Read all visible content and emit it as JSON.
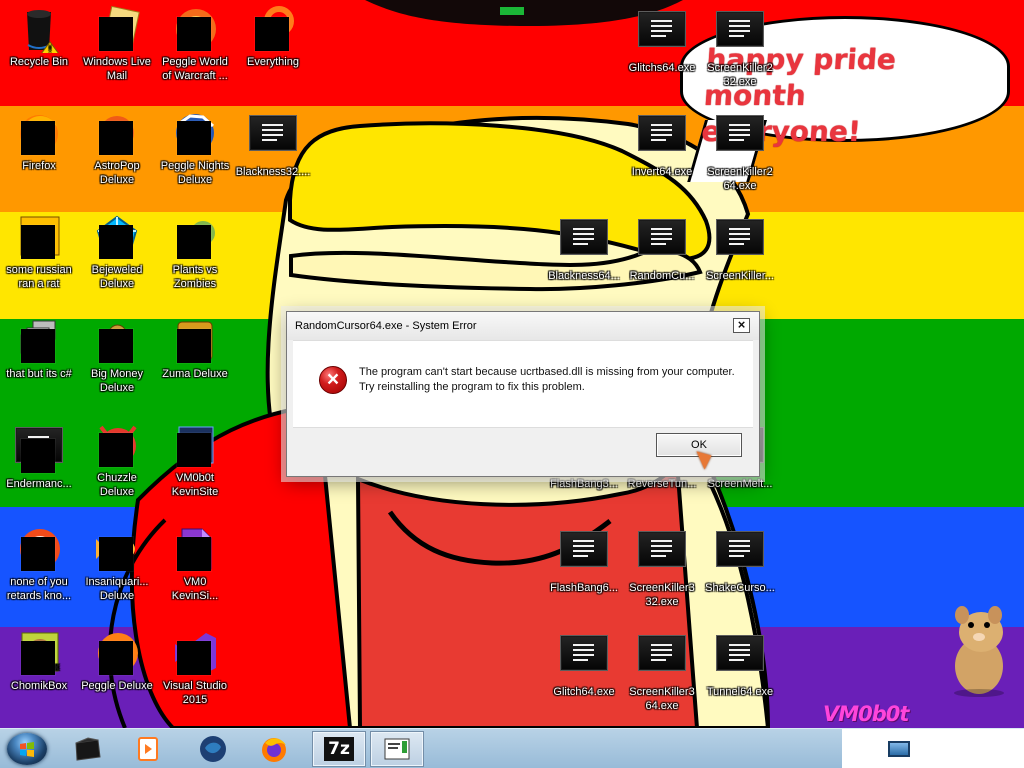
{
  "desktop": {
    "speech_bubble_text": "happy pride month\neveryone!",
    "corner_logo": "VM0b0t",
    "pride_colors": [
      "#ff0000",
      "#ff9800",
      "#ffe600",
      "#00a900",
      "#1654ff",
      "#6a1fb8"
    ]
  },
  "icons": [
    {
      "label": "Recycle Bin",
      "icon": "recycle-bin-icon"
    },
    {
      "label": "Windows Live\nMail",
      "icon": "windows-live-mail-icon"
    },
    {
      "label": "Peggle World\nof Warcraft ...",
      "icon": "peggle-world-of-warcraft-icon"
    },
    {
      "label": "Everything",
      "icon": "everything-search-icon"
    },
    {
      "label": "Firefox",
      "icon": "firefox-icon"
    },
    {
      "label": "AstroPop\nDeluxe",
      "icon": "astropop-icon"
    },
    {
      "label": "Peggle Nights\nDeluxe",
      "icon": "peggle-nights-icon"
    },
    {
      "label": "Blackness32....",
      "icon": "exe-icon"
    },
    {
      "label": "some russian\nran a rat",
      "icon": "adobe-after-effects-icon"
    },
    {
      "label": "Bejeweled\nDeluxe",
      "icon": "bejeweled-icon"
    },
    {
      "label": "Plants vs\nZombies",
      "icon": "plants-vs-zombies-icon"
    },
    {
      "label": "that but its c#",
      "icon": "stacked-windows-icon"
    },
    {
      "label": "Big Money\nDeluxe",
      "icon": "big-money-icon"
    },
    {
      "label": "Zuma Deluxe",
      "icon": "zuma-icon"
    },
    {
      "label": "Endermanc...",
      "icon": "exe-icon"
    },
    {
      "label": "Chuzzle\nDeluxe",
      "icon": "chuzzle-icon"
    },
    {
      "label": "VM0b0t\nKevinSite",
      "icon": "website-icon"
    },
    {
      "label": "none of you\nretards kno...",
      "icon": "red-circle-icon"
    },
    {
      "label": "Insaniquari...\nDeluxe",
      "icon": "insaniquarium-icon"
    },
    {
      "label": "VM0\nKevinSi...",
      "icon": "document-icon"
    },
    {
      "label": "ChomikBox",
      "icon": "chomikbox-icon"
    },
    {
      "label": "Peggle Deluxe",
      "icon": "peggle-deluxe-icon"
    },
    {
      "label": "Visual Studio\n2015",
      "icon": "visual-studio-icon"
    },
    {
      "label": "Glitchs64.exe",
      "icon": "exe-icon"
    },
    {
      "label": "ScreenKiller2\n32.exe",
      "icon": "exe-icon"
    },
    {
      "label": "Invert64.exe",
      "icon": "exe-icon"
    },
    {
      "label": "ScreenKiller2\n64.exe",
      "icon": "exe-icon"
    },
    {
      "label": "Blackness64...",
      "icon": "exe-icon"
    },
    {
      "label": "RandomCu...",
      "icon": "exe-icon"
    },
    {
      "label": "ScreenKiller...",
      "icon": "exe-icon"
    },
    {
      "label": "FlashBang3...",
      "icon": "exe-icon"
    },
    {
      "label": "ReverseTun...",
      "icon": "exe-icon"
    },
    {
      "label": "ScreenMelt...",
      "icon": "exe-icon"
    },
    {
      "label": "FlashBang6...",
      "icon": "exe-icon"
    },
    {
      "label": "ScreenKiller3\n32.exe",
      "icon": "exe-icon"
    },
    {
      "label": "ShakeCurso...",
      "icon": "exe-icon"
    },
    {
      "label": "Glitch64.exe",
      "icon": "exe-icon"
    },
    {
      "label": "ScreenKiller3\n64.exe",
      "icon": "exe-icon"
    },
    {
      "label": "Tunnel64.exe",
      "icon": "exe-icon"
    }
  ],
  "dialog": {
    "title": "RandomCursor64.exe - System Error",
    "close": "×",
    "message": "The program can't start because ucrtbased.dll is missing from your computer. Try reinstalling the program to fix this problem.",
    "ok": "OK",
    "error_icon": "×"
  },
  "taskbar": {
    "start_icon": "windows-start-icon",
    "items": [
      {
        "icon": "black-window-icon"
      },
      {
        "icon": "media-player-icon"
      },
      {
        "icon": "globe-icon"
      },
      {
        "icon": "firefox-icon"
      },
      {
        "icon": "7zip-icon",
        "label": "7z"
      },
      {
        "icon": "notes-window-icon"
      }
    ],
    "tray_icon": "monitor-icon"
  }
}
